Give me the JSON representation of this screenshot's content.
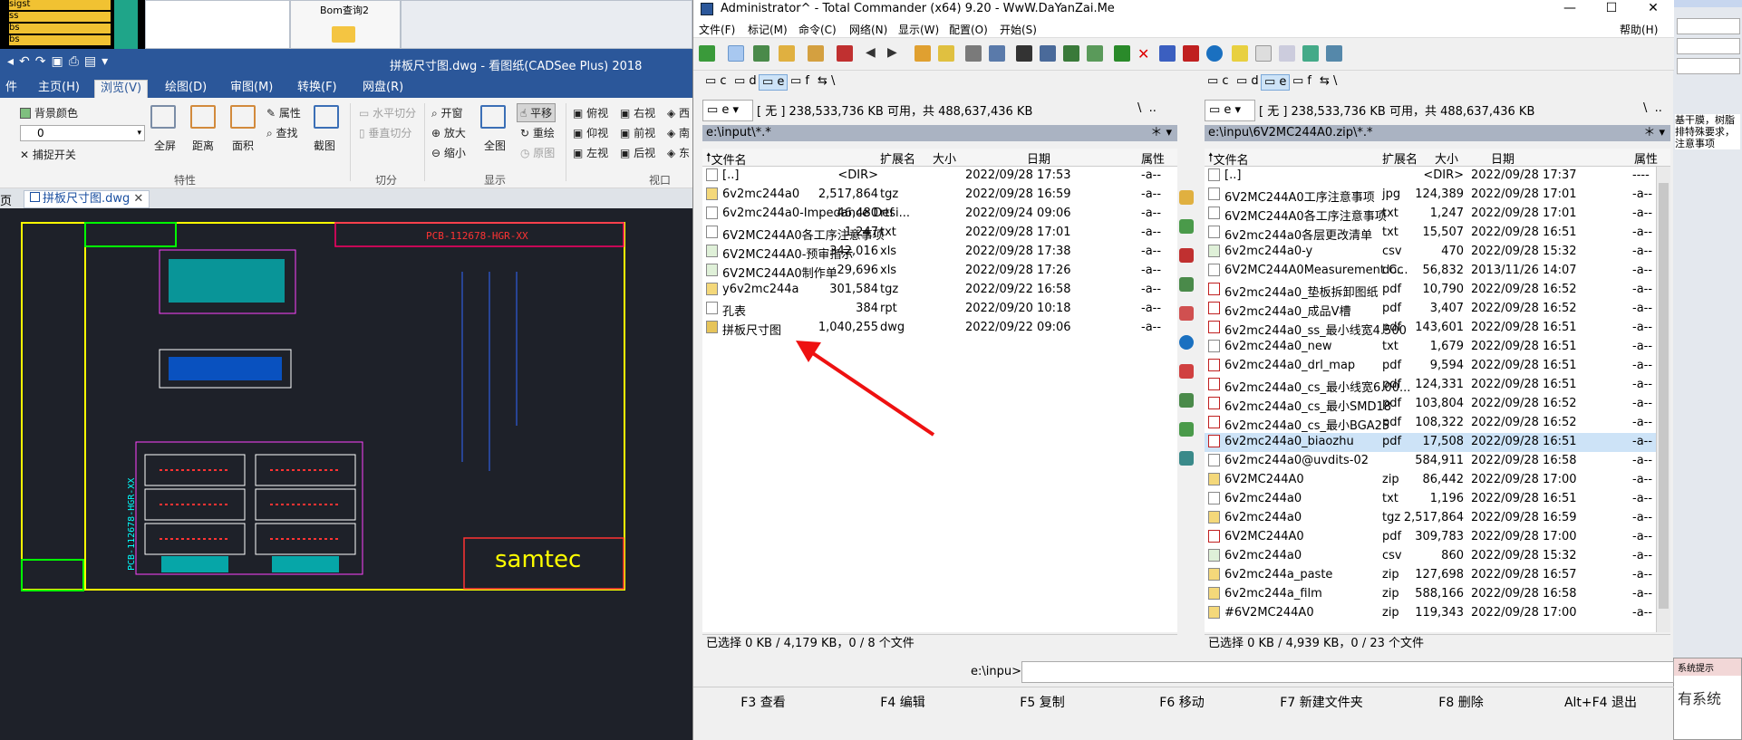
{
  "background": {
    "legend_items": [
      "sigst",
      "ss",
      "bs",
      "bs"
    ],
    "bom_window_title": "Bom查询2",
    "notif_title": "系统提示",
    "notif_body": "有系统",
    "side_text": [
      "基干膜，树脂",
      "排特殊要求，",
      "注意事项"
    ]
  },
  "cad": {
    "title": "拼板尺寸图.dwg - 看图纸(CADSee Plus) 2018",
    "tabs": [
      "件",
      "主页(H)",
      "浏览(V)",
      "绘图(D)",
      "审图(M)",
      "转换(F)",
      "网盘(R)"
    ],
    "ribbon": {
      "bg_color": "背景颜色",
      "attr": "属性",
      "find": "查找",
      "snap": "捕捉开关",
      "zoom_value": "0",
      "fullscreen": "全屏",
      "distance": "距离",
      "area": "面积",
      "screenshot": "截图",
      "h_split": "水平切分",
      "v_split": "垂直切分",
      "open_window": "开窗",
      "zoom_in": "放大",
      "zoom_out": "缩小",
      "full": "全图",
      "pan": "平移",
      "redraw": "重绘",
      "origin": "原图",
      "top_view": "俯视",
      "bottom_view": "仰视",
      "left_view": "左视",
      "right_view": "右视",
      "front_view": "前视",
      "back_view": "后视",
      "west": "西",
      "south": "南",
      "east": "东",
      "group_features": "特性",
      "group_split": "切分",
      "group_display": "显示",
      "group_view": "视口"
    },
    "doc_tab_left": "页",
    "doc_tab": "拼板尺寸图.dwg",
    "drawing": {
      "logo": "samtec",
      "part_no": "PCB-112678-HGR-XX",
      "part_no_vertical": "PCB-112678-HGR-XX"
    }
  },
  "tc": {
    "title": "Administrator^ - Total Commander (x64) 9.20 - WwW.DaYanZai.Me",
    "menu": [
      "文件(F)",
      "标记(M)",
      "命令(C)",
      "网络(N)",
      "显示(W)",
      "配置(O)",
      "开始(S)",
      "帮助(H)"
    ],
    "drives": [
      "c",
      "d",
      "e",
      "f"
    ],
    "left": {
      "drive": "e",
      "free": "[ 无 ]  238,533,736 KB 可用，共 488,637,436 KB",
      "path": "e:\\input\\*.*",
      "columns": [
        "文件名",
        "扩展名",
        "大小",
        "日期",
        "属性"
      ],
      "files": [
        {
          "name": "[..]",
          "ext": "",
          "size": "<DIR>",
          "date": "2022/09/28 17:53",
          "attr": "-a--"
        },
        {
          "name": "6v2mc244a0",
          "ext": "tgz",
          "size": "2,517,864",
          "date": "2022/09/28 16:59",
          "attr": "-a--"
        },
        {
          "name": "6v2mc244a0-Impedance Desi...",
          "ext": "rtf",
          "size": "46,480",
          "date": "2022/09/24 09:06",
          "attr": "-a--"
        },
        {
          "name": "6V2MC244A0各工序注意事项",
          "ext": "txt",
          "size": "1,247",
          "date": "2022/09/28 17:01",
          "attr": "-a--"
        },
        {
          "name": "6V2MC244A0-预审指示",
          "ext": "xls",
          "size": "342,016",
          "date": "2022/09/28 17:38",
          "attr": "-a--"
        },
        {
          "name": "6V2MC244A0制作单",
          "ext": "xls",
          "size": "29,696",
          "date": "2022/09/28 17:26",
          "attr": "-a--"
        },
        {
          "name": "y6v2mc244a",
          "ext": "tgz",
          "size": "301,584",
          "date": "2022/09/22 16:58",
          "attr": "-a--"
        },
        {
          "name": "孔表",
          "ext": "rpt",
          "size": "384",
          "date": "2022/09/20 10:18",
          "attr": "-a--"
        },
        {
          "name": "拼板尺寸图",
          "ext": "dwg",
          "size": "1,040,255",
          "date": "2022/09/22 09:06",
          "attr": "-a--"
        }
      ],
      "status": "已选择 0 KB / 4,179 KB，0 / 8 个文件"
    },
    "right": {
      "drive": "e",
      "free": "[ 无 ]  238,533,736 KB 可用，共 488,637,436 KB",
      "path": "e:\\inpu\\6V2MC244A0.zip\\*.*",
      "columns": [
        "文件名",
        "扩展名",
        "大小",
        "日期",
        "属性"
      ],
      "files": [
        {
          "name": "[..]",
          "ext": "",
          "size": "<DIR>",
          "date": "2022/09/28 17:37",
          "attr": "----"
        },
        {
          "name": "6V2MC244A0工序注意事项",
          "ext": "jpg",
          "size": "124,389",
          "date": "2022/09/28 17:01",
          "attr": "-a--"
        },
        {
          "name": "6V2MC244A0各工序注意事项",
          "ext": "txt",
          "size": "1,247",
          "date": "2022/09/28 17:01",
          "attr": "-a--"
        },
        {
          "name": "6v2mc244a0各层更改清单",
          "ext": "txt",
          "size": "15,507",
          "date": "2022/09/28 16:51",
          "attr": "-a--"
        },
        {
          "name": "6v2mc244a0-y",
          "ext": "csv",
          "size": "470",
          "date": "2022/09/28 15:32",
          "attr": "-a--"
        },
        {
          "name": "6V2MC244A0Measurement C...",
          "ext": "doc",
          "size": "56,832",
          "date": "2013/11/26 14:07",
          "attr": "-a--"
        },
        {
          "name": "6v2mc244a0_垫板拆卸图纸",
          "ext": "pdf",
          "size": "10,790",
          "date": "2022/09/28 16:52",
          "attr": "-a--"
        },
        {
          "name": "6v2mc244a0_成品V槽",
          "ext": "pdf",
          "size": "3,407",
          "date": "2022/09/28 16:52",
          "attr": "-a--"
        },
        {
          "name": "6v2mc244a0_ss_最小线宽4.500",
          "ext": "pdf",
          "size": "143,601",
          "date": "2022/09/28 16:51",
          "attr": "-a--"
        },
        {
          "name": "6v2mc244a0_new",
          "ext": "txt",
          "size": "1,679",
          "date": "2022/09/28 16:51",
          "attr": "-a--"
        },
        {
          "name": "6v2mc244a0_drl_map",
          "ext": "pdf",
          "size": "9,594",
          "date": "2022/09/28 16:51",
          "attr": "-a--"
        },
        {
          "name": "6v2mc244a0_cs_最小线宽6.00...",
          "ext": "pdf",
          "size": "124,331",
          "date": "2022/09/28 16:51",
          "attr": "-a--"
        },
        {
          "name": "6v2mc244a0_cs_最小SMD18",
          "ext": "pdf",
          "size": "103,804",
          "date": "2022/09/28 16:52",
          "attr": "-a--"
        },
        {
          "name": "6v2mc244a0_cs_最小BGA25",
          "ext": "pdf",
          "size": "108,322",
          "date": "2022/09/28 16:52",
          "attr": "-a--"
        },
        {
          "name": "6v2mc244a0_biaozhu",
          "ext": "pdf",
          "size": "17,508",
          "date": "2022/09/28 16:51",
          "attr": "-a--"
        },
        {
          "name": "6v2mc244a0@uvdits-02",
          "ext": "",
          "size": "584,911",
          "date": "2022/09/28 16:58",
          "attr": "-a--"
        },
        {
          "name": "6V2MC244A0",
          "ext": "zip",
          "size": "86,442",
          "date": "2022/09/28 17:00",
          "attr": "-a--"
        },
        {
          "name": "6v2mc244a0",
          "ext": "txt",
          "size": "1,196",
          "date": "2022/09/28 16:51",
          "attr": "-a--"
        },
        {
          "name": "6v2mc244a0",
          "ext": "tgz",
          "size": "2,517,864",
          "date": "2022/09/28 16:59",
          "attr": "-a--"
        },
        {
          "name": "6V2MC244A0",
          "ext": "pdf",
          "size": "309,783",
          "date": "2022/09/28 17:00",
          "attr": "-a--"
        },
        {
          "name": "6v2mc244a0",
          "ext": "csv",
          "size": "860",
          "date": "2022/09/28 15:32",
          "attr": "-a--"
        },
        {
          "name": "6v2mc244a_paste",
          "ext": "zip",
          "size": "127,698",
          "date": "2022/09/28 16:57",
          "attr": "-a--"
        },
        {
          "name": "6v2mc244a_film",
          "ext": "zip",
          "size": "588,166",
          "date": "2022/09/28 16:58",
          "attr": "-a--"
        },
        {
          "name": "#6V2MC244A0",
          "ext": "zip",
          "size": "119,343",
          "date": "2022/09/28 17:00",
          "attr": "-a--"
        }
      ],
      "status": "已选择 0 KB / 4,939 KB，0 / 23 个文件"
    },
    "cmd_label": "e:\\inpu>",
    "fkeys": [
      "F3 查看",
      "F4 编辑",
      "F5 复制",
      "F6 移动",
      "F7 新建文件夹",
      "F8 删除",
      "Alt+F4 退出"
    ]
  }
}
